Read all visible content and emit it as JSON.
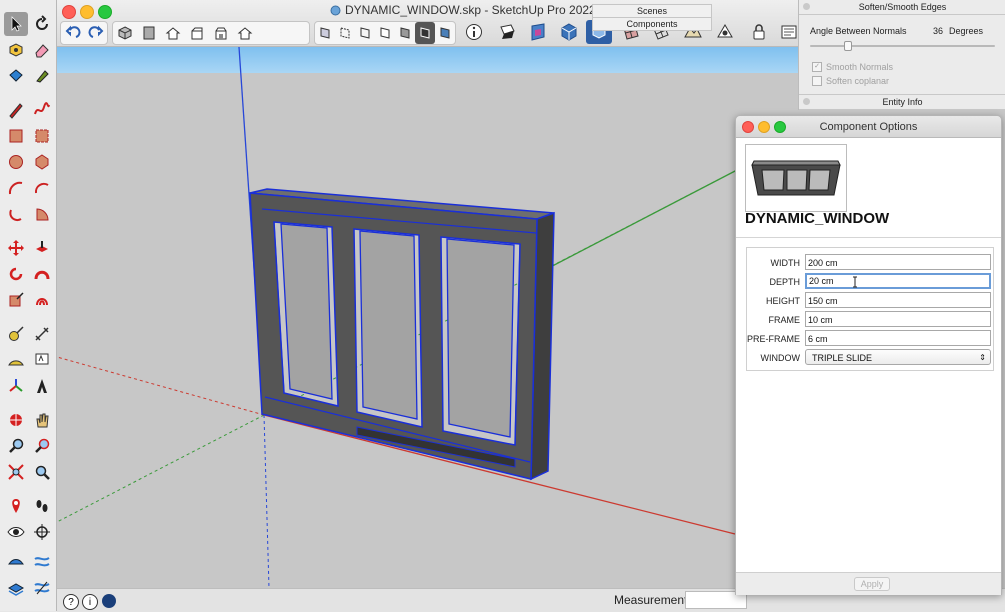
{
  "window": {
    "title": "DYNAMIC_WINDOW.skp - SketchUp Pro 2022"
  },
  "trays": {
    "scenes": "Scenes",
    "components": "Components"
  },
  "soften_panel": {
    "title": "Soften/Smooth Edges",
    "angle_label": "Angle Between Normals",
    "angle_value": "36",
    "angle_unit": "Degrees",
    "smooth_normals": "Smooth Normals",
    "soften_coplanar": "Soften coplanar",
    "entity_info": "Entity Info"
  },
  "component_options": {
    "title": "Component Options",
    "component_name": "DYNAMIC_WINDOW",
    "fields": [
      {
        "label": "WIDTH",
        "value": "200 cm"
      },
      {
        "label": "DEPTH",
        "value": "20 cm"
      },
      {
        "label": "HEIGHT",
        "value": "150 cm"
      },
      {
        "label": "FRAME",
        "value": "10 cm"
      },
      {
        "label": "PRE-FRAME",
        "value": "6 cm"
      }
    ],
    "window_select": {
      "label": "WINDOW",
      "value": "TRIPLE SLIDE"
    },
    "apply_label": "Apply"
  },
  "statusbar": {
    "measurements_label": "Measurements",
    "measurements_value": "",
    "info_icon": "i"
  },
  "colors": {
    "axis_blue": "#2747d8",
    "axis_red": "#cc3a30",
    "axis_green": "#3a9a3a",
    "selection": "#1a2fd8",
    "sky": "#a9d6f5",
    "ground": "#c7c7c7"
  }
}
